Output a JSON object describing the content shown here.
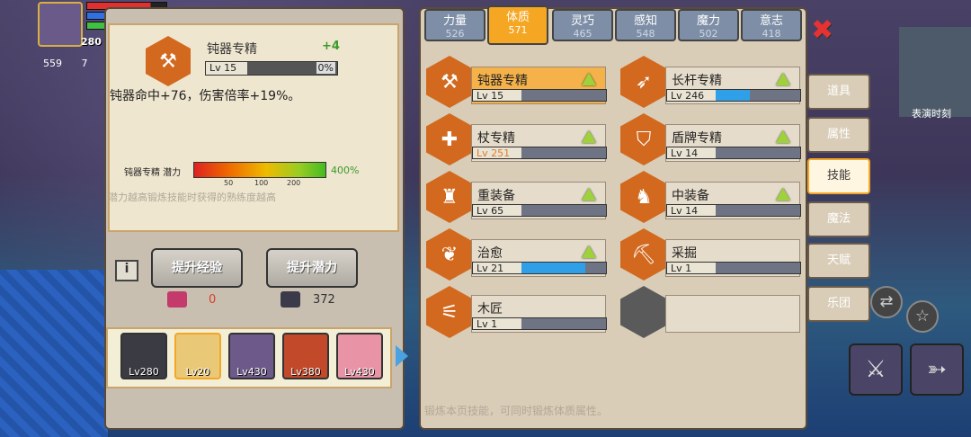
{
  "hud": {
    "level": "280",
    "side_a": "559",
    "side_b": "7",
    "minimap_label": "表演时刻"
  },
  "detail": {
    "name": "钝器专精",
    "bonus": "+4",
    "level": "Lv 15",
    "progress_text": "0%",
    "progress": 0,
    "description": "钝器命中+76，伤害倍率+19%。",
    "potential_label": "钝器专精 潜力",
    "potential_pct": "400%",
    "potential_ticks": [
      "50",
      "100",
      "200"
    ],
    "hint": "潜力越高锻炼技能时获得的熟练度越高",
    "info_icon": "i",
    "btn_exp": "提升经验",
    "btn_potential": "提升潜力",
    "cost_exp": "0",
    "cost_potential": "372"
  },
  "party": [
    {
      "level": "Lv280"
    },
    {
      "level": "Lv20"
    },
    {
      "level": "Lv430"
    },
    {
      "level": "Lv380"
    },
    {
      "level": "Lv430"
    }
  ],
  "tabs": [
    {
      "label": "力量",
      "value": "526"
    },
    {
      "label": "体质",
      "value": "571"
    },
    {
      "label": "灵巧",
      "value": "465"
    },
    {
      "label": "感知",
      "value": "548"
    },
    {
      "label": "魔力",
      "value": "502"
    },
    {
      "label": "意志",
      "value": "418"
    }
  ],
  "skills": [
    {
      "name": "钝器专精",
      "level": "Lv 15",
      "fill": 0
    },
    {
      "name": "长杆专精",
      "level": "Lv 246",
      "fill": 0.4
    },
    {
      "name": "杖专精",
      "level": "Lv 251",
      "fill": 0
    },
    {
      "name": "盾牌专精",
      "level": "Lv 14",
      "fill": 0
    },
    {
      "name": "重装备",
      "level": "Lv 65",
      "fill": 0
    },
    {
      "name": "中装备",
      "level": "Lv 14",
      "fill": 0
    },
    {
      "name": "治愈",
      "level": "Lv 21",
      "fill": 0.75
    },
    {
      "name": "采掘",
      "level": "Lv 1",
      "fill": 0
    },
    {
      "name": "木匠",
      "level": "Lv 1",
      "fill": 0
    }
  ],
  "footer": "锻炼本页技能，可同时锻炼体质属性。",
  "side_menu": [
    "道具",
    "属性",
    "技能",
    "魔法",
    "天赋",
    "乐团"
  ],
  "close_icon": "✖",
  "colors": {
    "accent": "#f5a623",
    "hex": "#d2691e",
    "upgrade": "#9fd23a",
    "exp_fill": "#2fa0e8"
  }
}
